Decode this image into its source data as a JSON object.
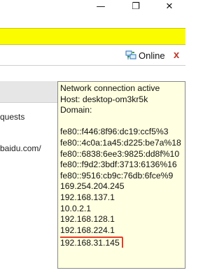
{
  "tooltip": {
    "status": "Network connection active",
    "host": "Host: desktop-om3kr5k",
    "domain": "Domain:",
    "addresses": [
      "fe80::f446:8f96:dc19:ccf5%3",
      "fe80::4c0a:1a45:d225:be7a%18",
      "fe80::6838:6ee3:9825:dd8f%10",
      "fe80::f9d2:3bdf:3713:6136%16",
      "fe80::9516:cb9c:76db:6fce%9",
      "169.254.204.245",
      "192.168.137.1",
      "10.0.2.1",
      "192.168.128.1",
      "192.168.224.1"
    ],
    "highlighted_address": "192.168.31.145",
    "highlight_color": "#e53c2a"
  },
  "toolbar": {
    "online_label": "Online",
    "close_label": "x",
    "close_color": "#c0392b"
  },
  "window": {
    "minimize_glyph": "—",
    "restore_glyph": "❐",
    "close_glyph": "✕"
  },
  "left_panel": {
    "requests_text": "quests",
    "url_text": "baidu.com/"
  },
  "colors": {
    "notification_bar": "#fcfc00",
    "tooltip_bg": "#ffffe1"
  },
  "icons": [
    "network-monitor-icon",
    "close-icon",
    "minimize-icon",
    "restore-icon"
  ]
}
